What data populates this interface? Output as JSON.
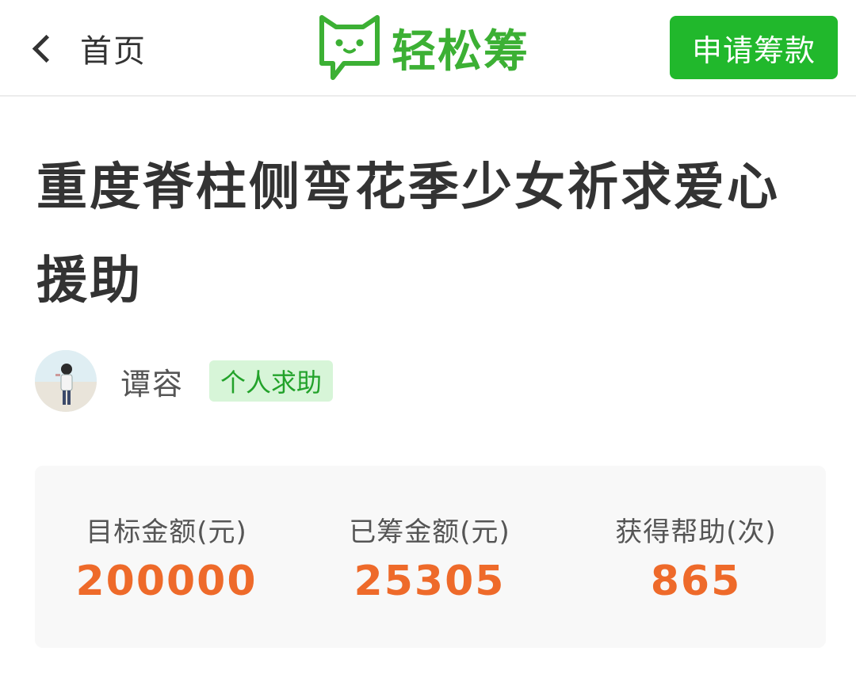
{
  "header": {
    "back_label": "首页",
    "logo_text": "轻松筹",
    "apply_button": "申请筹款"
  },
  "title": "重度脊柱侧弯花季少女祈求爱心援助",
  "author": {
    "name": "谭容",
    "tag": "个人求助"
  },
  "stats": [
    {
      "label": "目标金额(元)",
      "value": "200000"
    },
    {
      "label": "已筹金额(元)",
      "value": "25305"
    },
    {
      "label": "获得帮助(次)",
      "value": "865"
    }
  ],
  "colors": {
    "brand_green": "#3cb034",
    "button_green": "#21b82c",
    "tag_bg": "#d7f5d8",
    "tag_text": "#22a22a",
    "value_orange": "#ee6a2a"
  }
}
